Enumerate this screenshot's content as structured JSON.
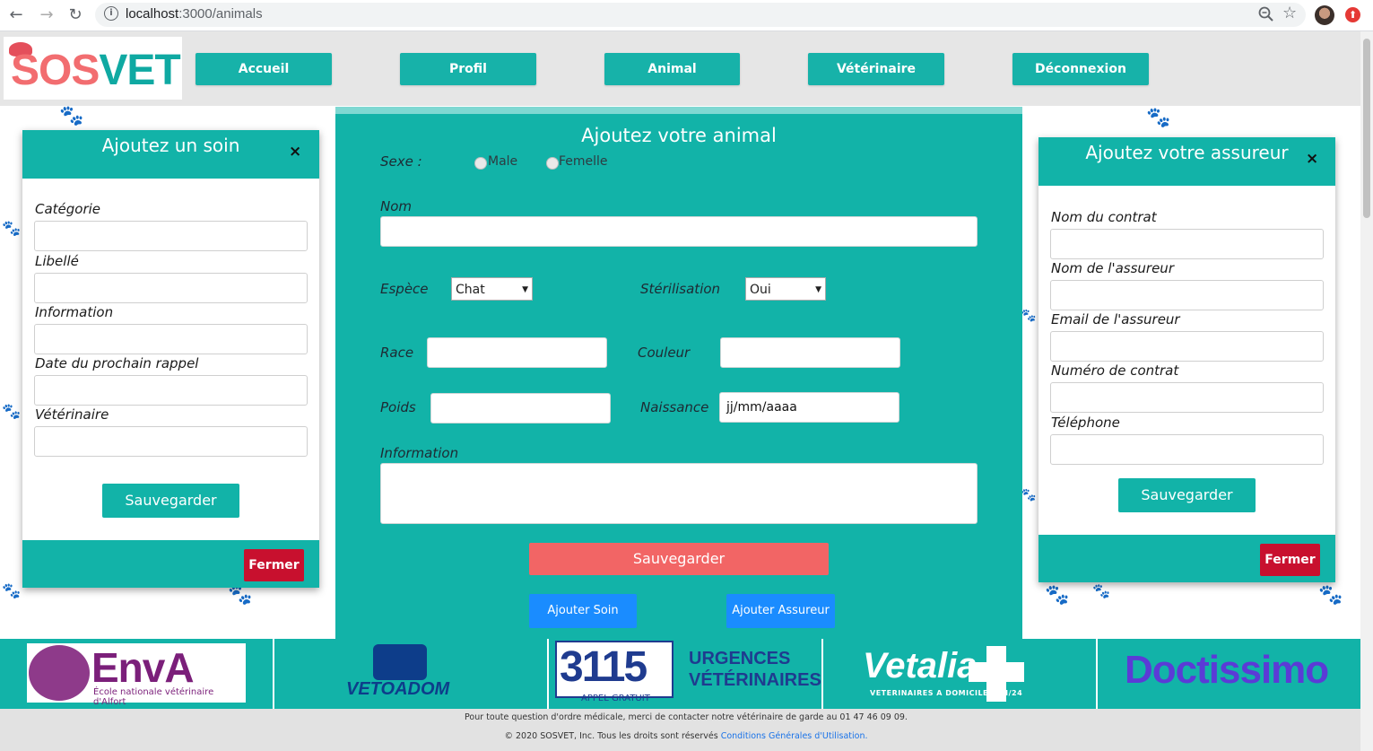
{
  "browser": {
    "url_host": "localhost",
    "url_path": ":3000/animals"
  },
  "header": {
    "logo_sos": "SOS",
    "logo_vet": "VET",
    "nav": [
      "Accueil",
      "Profil",
      "Animal",
      "Vétérinaire",
      "Déconnexion"
    ]
  },
  "soin_modal": {
    "title": "Ajoutez un soin",
    "close": "×",
    "fields": [
      "Catégorie",
      "Libellé",
      "Information",
      "Date du prochain rappel",
      "Vétérinaire"
    ],
    "save": "Sauvegarder",
    "close_button": "Fermer"
  },
  "animal_form": {
    "title": "Ajoutez votre animal",
    "sexe_label": "Sexe :",
    "sexe_options": [
      "Male",
      "Femelle"
    ],
    "nom_label": "Nom",
    "espece_label": "Espèce",
    "espece_value": "Chat",
    "sterilisation_label": "Stérilisation",
    "sterilisation_value": "Oui",
    "race_label": "Race",
    "couleur_label": "Couleur",
    "poids_label": "Poids",
    "naissance_label": "Naissance",
    "naissance_placeholder": "jj/mm/aaaa",
    "information_label": "Information",
    "save": "Sauvegarder",
    "add_soin": "Ajouter Soin",
    "add_assureur": "Ajouter Assureur"
  },
  "assureur_modal": {
    "title": "Ajoutez votre assureur",
    "close": "×",
    "fields": [
      "Nom du contrat",
      "Nom de l'assureur",
      "Email de l'assureur",
      "Numéro de contrat",
      "Téléphone"
    ],
    "save": "Sauvegarder",
    "close_button": "Fermer"
  },
  "partners": {
    "enva_big": "EnvA",
    "enva_small": "École nationale vétérinaire d'Alfort",
    "vetoadom": "VETOADOM",
    "n3115": "3115",
    "appel": "APPEL GRATUIT",
    "urgences_1": "URGENCES",
    "urgences_2": "VÉTÉRINAIRES",
    "vetalia": "Vetalia",
    "vetalia_sub": "VETERINAIRES A DOMICILE 24H/24",
    "doctissimo": "Doctissimo"
  },
  "footer": {
    "line1": "Pour toute question d'ordre médicale, merci de contacter notre vétérinaire de garde au 01 47 46 09 09.",
    "line2": "© 2020 SOSVET, Inc. Tous les droits sont réservés",
    "link": "Conditions Générales d'Utilisation."
  },
  "colors": {
    "teal": "#12b3a8",
    "coral": "#f26565",
    "blue": "#1a8cff",
    "red": "#c8102e"
  },
  "icons": [
    "back-arrow-icon",
    "forward-arrow-icon",
    "reload-icon",
    "info-icon",
    "zoom-icon",
    "star-icon",
    "close-icon",
    "paw-icon"
  ]
}
